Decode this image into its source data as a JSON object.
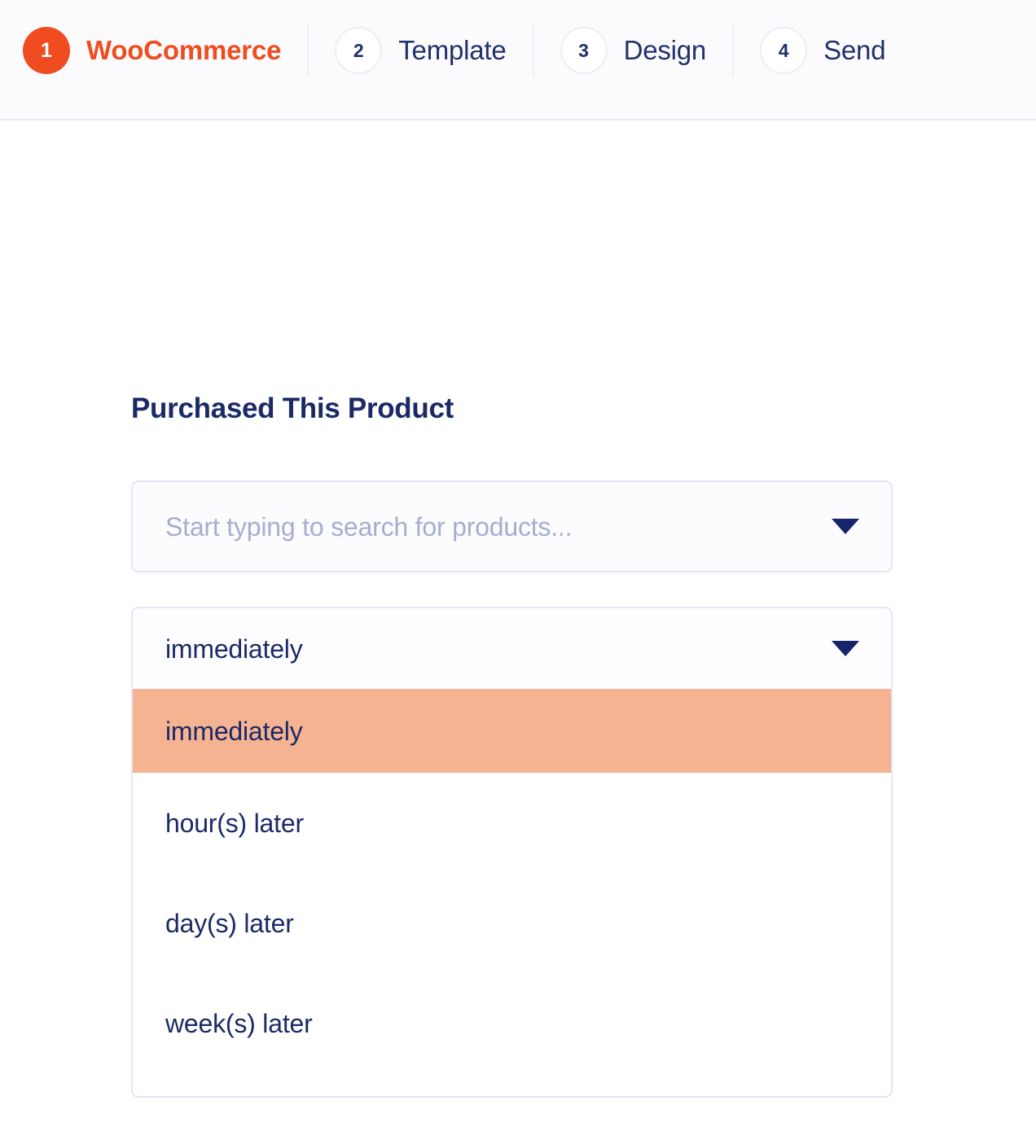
{
  "header": {
    "steps": [
      {
        "number": "1",
        "label": "WooCommerce",
        "state": "active"
      },
      {
        "number": "2",
        "label": "Template",
        "state": "inactive"
      },
      {
        "number": "3",
        "label": "Design",
        "state": "inactive"
      },
      {
        "number": "4",
        "label": "Send",
        "state": "inactive"
      }
    ]
  },
  "main": {
    "section_title": "Purchased This Product",
    "product_search": {
      "value": "",
      "placeholder": "Start typing to search for products...",
      "caret_icon": "chevron-down-icon"
    },
    "timing_select": {
      "selected_value": "immediately",
      "caret_icon": "chevron-down-icon",
      "options": [
        {
          "label": "immediately",
          "selected": true
        },
        {
          "label": "hour(s) later",
          "selected": false
        },
        {
          "label": "day(s) later",
          "selected": false
        },
        {
          "label": "week(s) later",
          "selected": false
        }
      ]
    }
  },
  "colors": {
    "accent_orange": "#ef4d20",
    "navy_text": "#1b2a66",
    "highlight_peach": "#f6b392",
    "border_lavender": "#e3e6f4",
    "placeholder_gray": "#a7adcf"
  }
}
